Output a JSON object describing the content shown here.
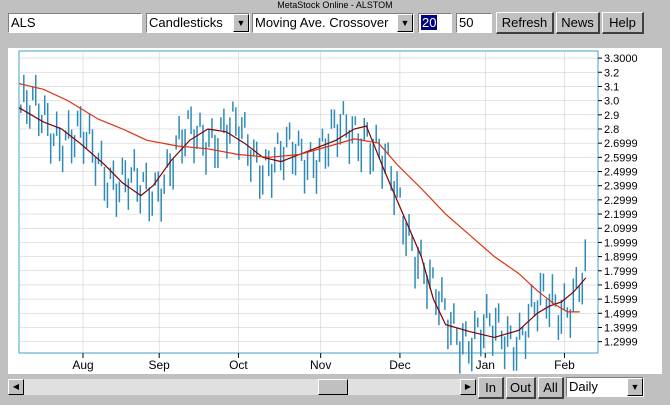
{
  "window": {
    "title": "MetaStock Online - ALSTOM"
  },
  "toolbar": {
    "symbol": "ALS",
    "chart_type": "Candlesticks",
    "indicator": "Moving Ave. Crossover",
    "param1": "20",
    "param2": "50",
    "refresh_label": "Refresh",
    "news_label": "News",
    "help_label": "Help"
  },
  "bottom": {
    "zoom_in_label": "In",
    "zoom_out_label": "Out",
    "all_label": "All",
    "period": "Daily"
  },
  "icons": {
    "dropdown": "chevron-down-icon",
    "scroll_left": "arrow-left-icon",
    "scroll_right": "arrow-right-icon"
  },
  "colors": {
    "candle": "#2e8bb8",
    "ma_short": "#800000",
    "ma_long": "#e03010",
    "grid": "#c8c8c8",
    "frame": "#3fa0c8"
  },
  "chart_data": {
    "type": "line",
    "title": "",
    "ylim": [
      1.22,
      3.35
    ],
    "x_months": [
      "Aug",
      "Sep",
      "Oct",
      "Nov",
      "Dec",
      "Jan",
      "Feb"
    ],
    "y_ticks": [
      "3.3000",
      "3.2",
      "3.1",
      "3.0",
      "2.9",
      "2.8",
      "2.6999",
      "2.5999",
      "2.4999",
      "2.3999",
      "2.2999",
      "2.1999",
      "2.0999",
      "1.9999",
      "1.8999",
      "1.7999",
      "1.6999",
      "1.5999",
      "1.4999",
      "1.3999",
      "1.2999"
    ],
    "y_tick_values": [
      3.3,
      3.2,
      3.1,
      3.0,
      2.9,
      2.8,
      2.7,
      2.6,
      2.5,
      2.4,
      2.3,
      2.2,
      2.1,
      2.0,
      1.9,
      1.8,
      1.7,
      1.6,
      1.5,
      1.4,
      1.3
    ],
    "month_positions": [
      10.5,
      23,
      36,
      49.5,
      62.5,
      76.5,
      89.5
    ],
    "x_range": [
      0,
      95
    ],
    "series": [
      {
        "points": [
          [
            0,
            2.95
          ],
          [
            4,
            2.85
          ],
          [
            7,
            2.8
          ],
          [
            10,
            2.7
          ],
          [
            14,
            2.55
          ],
          [
            17,
            2.42
          ],
          [
            20,
            2.33
          ],
          [
            22,
            2.4
          ],
          [
            25,
            2.58
          ],
          [
            28,
            2.72
          ],
          [
            31,
            2.8
          ],
          [
            34,
            2.78
          ],
          [
            37,
            2.7
          ],
          [
            40,
            2.6
          ],
          [
            43,
            2.57
          ],
          [
            46,
            2.62
          ],
          [
            49,
            2.67
          ],
          [
            52,
            2.72
          ],
          [
            55,
            2.8
          ],
          [
            57,
            2.82
          ],
          [
            60,
            2.5
          ],
          [
            63,
            2.2
          ],
          [
            66,
            1.9
          ],
          [
            68,
            1.6
          ],
          [
            70,
            1.42
          ],
          [
            74,
            1.37
          ],
          [
            78,
            1.33
          ],
          [
            82,
            1.38
          ],
          [
            85,
            1.5
          ],
          [
            87,
            1.55
          ],
          [
            89,
            1.58
          ],
          [
            91,
            1.65
          ],
          [
            93,
            1.75
          ]
        ]
      },
      {
        "points": [
          [
            0,
            3.12
          ],
          [
            4,
            3.08
          ],
          [
            8,
            3.0
          ],
          [
            13,
            2.87
          ],
          [
            17,
            2.8
          ],
          [
            21,
            2.72
          ],
          [
            26,
            2.68
          ],
          [
            31,
            2.66
          ],
          [
            36,
            2.62
          ],
          [
            41,
            2.6
          ],
          [
            46,
            2.62
          ],
          [
            51,
            2.68
          ],
          [
            55,
            2.73
          ],
          [
            59,
            2.7
          ],
          [
            62,
            2.55
          ],
          [
            66,
            2.38
          ],
          [
            70,
            2.2
          ],
          [
            74,
            2.05
          ],
          [
            78,
            1.9
          ],
          [
            82,
            1.78
          ],
          [
            85,
            1.66
          ],
          [
            88,
            1.56
          ],
          [
            90,
            1.51
          ],
          [
            92,
            1.51
          ]
        ]
      }
    ]
  }
}
